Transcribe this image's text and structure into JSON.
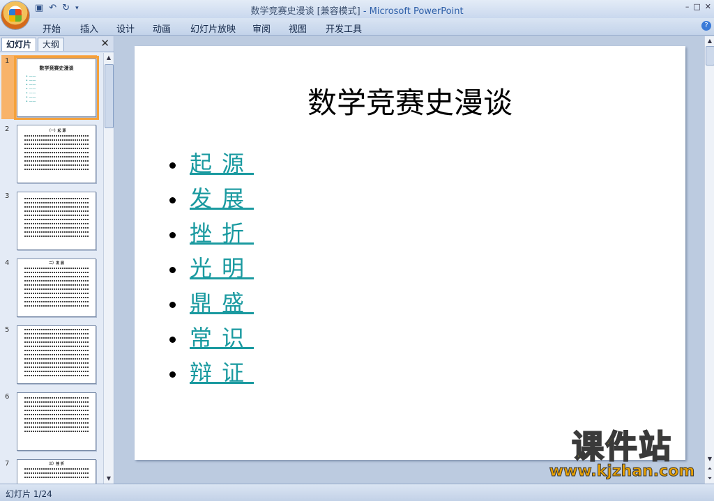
{
  "window": {
    "doc_title": "数学竞赛史漫谈 [兼容模式]",
    "app_title": " - Microsoft PowerPoint",
    "controls": [
      "–",
      "□",
      "✕"
    ]
  },
  "ribbon": {
    "tabs": [
      "开始",
      "插入",
      "设计",
      "动画",
      "幻灯片放映",
      "审阅",
      "视图",
      "开发工具"
    ],
    "help": "?"
  },
  "panel": {
    "tab_slides": "幻灯片",
    "tab_outline": "大纲",
    "close": "✕",
    "thumbnails": [
      {
        "num": "1",
        "title": "数学竞赛史漫谈"
      },
      {
        "num": "2",
        "title": "（一）起 源"
      },
      {
        "num": "3",
        "title": ""
      },
      {
        "num": "4",
        "title": "二）发 展"
      },
      {
        "num": "5",
        "title": ""
      },
      {
        "num": "6",
        "title": ""
      },
      {
        "num": "7",
        "title": "三）挫 折"
      }
    ]
  },
  "slide": {
    "title": "数学竞赛史漫谈",
    "bullets": [
      "起源",
      "发展",
      "挫折",
      "光明",
      "鼎盛",
      "常识",
      "辩证"
    ]
  },
  "status": {
    "slide_indicator": "幻灯片 1/24"
  },
  "watermark": {
    "main": "课件站",
    "url": "www.kjzhan.com"
  }
}
